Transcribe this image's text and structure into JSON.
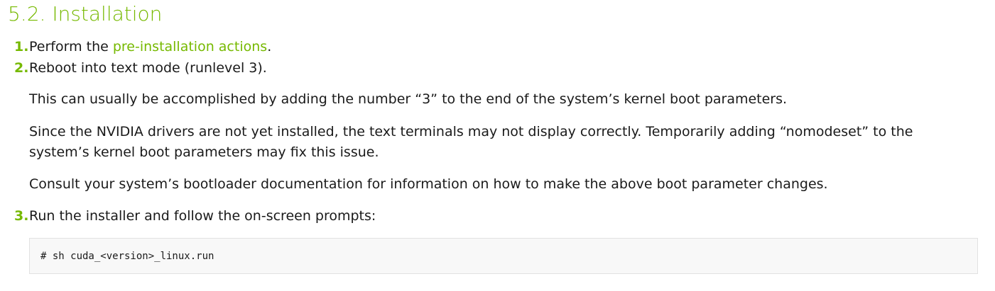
{
  "section": {
    "title": "5.2. Installation"
  },
  "steps": [
    {
      "number": "1.",
      "text_before": "Perform the ",
      "link_text": "pre-installation actions",
      "text_after": "."
    },
    {
      "number": "2.",
      "text": "Reboot into text mode (runlevel 3).",
      "paragraphs": [
        "This can usually be accomplished by adding the number “3” to the end of the system’s kernel boot parameters.",
        "Since the NVIDIA drivers are not yet installed, the text terminals may not display correctly. Temporarily adding “nomodeset” to the system’s kernel boot parameters may fix this issue.",
        "Consult your system’s bootloader documentation for information on how to make the above boot parameter changes."
      ]
    },
    {
      "number": "3.",
      "text": "Run the installer and follow the on-screen prompts:",
      "code": "# sh cuda_<version>_linux.run"
    }
  ],
  "colors": {
    "accent": "#76b900",
    "text": "#1a1a1a",
    "code_bg": "#f8f8f8",
    "code_border": "#e1e1e1"
  }
}
